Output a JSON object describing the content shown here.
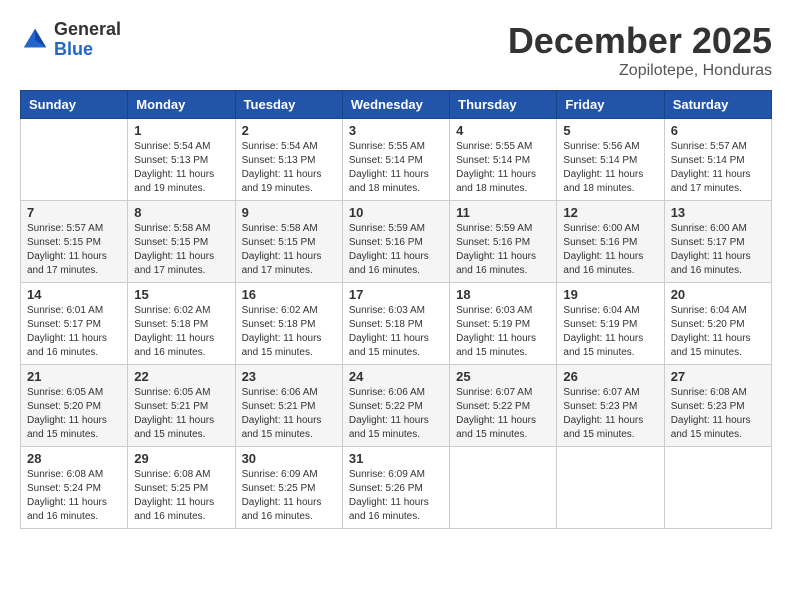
{
  "header": {
    "logo": {
      "general": "General",
      "blue": "Blue"
    },
    "title": "December 2025",
    "subtitle": "Zopilotepe, Honduras"
  },
  "calendar": {
    "days_of_week": [
      "Sunday",
      "Monday",
      "Tuesday",
      "Wednesday",
      "Thursday",
      "Friday",
      "Saturday"
    ],
    "weeks": [
      [
        {
          "day": "",
          "info": ""
        },
        {
          "day": "1",
          "info": "Sunrise: 5:54 AM\nSunset: 5:13 PM\nDaylight: 11 hours\nand 19 minutes."
        },
        {
          "day": "2",
          "info": "Sunrise: 5:54 AM\nSunset: 5:13 PM\nDaylight: 11 hours\nand 19 minutes."
        },
        {
          "day": "3",
          "info": "Sunrise: 5:55 AM\nSunset: 5:14 PM\nDaylight: 11 hours\nand 18 minutes."
        },
        {
          "day": "4",
          "info": "Sunrise: 5:55 AM\nSunset: 5:14 PM\nDaylight: 11 hours\nand 18 minutes."
        },
        {
          "day": "5",
          "info": "Sunrise: 5:56 AM\nSunset: 5:14 PM\nDaylight: 11 hours\nand 18 minutes."
        },
        {
          "day": "6",
          "info": "Sunrise: 5:57 AM\nSunset: 5:14 PM\nDaylight: 11 hours\nand 17 minutes."
        }
      ],
      [
        {
          "day": "7",
          "info": "Sunrise: 5:57 AM\nSunset: 5:15 PM\nDaylight: 11 hours\nand 17 minutes."
        },
        {
          "day": "8",
          "info": "Sunrise: 5:58 AM\nSunset: 5:15 PM\nDaylight: 11 hours\nand 17 minutes."
        },
        {
          "day": "9",
          "info": "Sunrise: 5:58 AM\nSunset: 5:15 PM\nDaylight: 11 hours\nand 17 minutes."
        },
        {
          "day": "10",
          "info": "Sunrise: 5:59 AM\nSunset: 5:16 PM\nDaylight: 11 hours\nand 16 minutes."
        },
        {
          "day": "11",
          "info": "Sunrise: 5:59 AM\nSunset: 5:16 PM\nDaylight: 11 hours\nand 16 minutes."
        },
        {
          "day": "12",
          "info": "Sunrise: 6:00 AM\nSunset: 5:16 PM\nDaylight: 11 hours\nand 16 minutes."
        },
        {
          "day": "13",
          "info": "Sunrise: 6:00 AM\nSunset: 5:17 PM\nDaylight: 11 hours\nand 16 minutes."
        }
      ],
      [
        {
          "day": "14",
          "info": "Sunrise: 6:01 AM\nSunset: 5:17 PM\nDaylight: 11 hours\nand 16 minutes."
        },
        {
          "day": "15",
          "info": "Sunrise: 6:02 AM\nSunset: 5:18 PM\nDaylight: 11 hours\nand 16 minutes."
        },
        {
          "day": "16",
          "info": "Sunrise: 6:02 AM\nSunset: 5:18 PM\nDaylight: 11 hours\nand 15 minutes."
        },
        {
          "day": "17",
          "info": "Sunrise: 6:03 AM\nSunset: 5:18 PM\nDaylight: 11 hours\nand 15 minutes."
        },
        {
          "day": "18",
          "info": "Sunrise: 6:03 AM\nSunset: 5:19 PM\nDaylight: 11 hours\nand 15 minutes."
        },
        {
          "day": "19",
          "info": "Sunrise: 6:04 AM\nSunset: 5:19 PM\nDaylight: 11 hours\nand 15 minutes."
        },
        {
          "day": "20",
          "info": "Sunrise: 6:04 AM\nSunset: 5:20 PM\nDaylight: 11 hours\nand 15 minutes."
        }
      ],
      [
        {
          "day": "21",
          "info": "Sunrise: 6:05 AM\nSunset: 5:20 PM\nDaylight: 11 hours\nand 15 minutes."
        },
        {
          "day": "22",
          "info": "Sunrise: 6:05 AM\nSunset: 5:21 PM\nDaylight: 11 hours\nand 15 minutes."
        },
        {
          "day": "23",
          "info": "Sunrise: 6:06 AM\nSunset: 5:21 PM\nDaylight: 11 hours\nand 15 minutes."
        },
        {
          "day": "24",
          "info": "Sunrise: 6:06 AM\nSunset: 5:22 PM\nDaylight: 11 hours\nand 15 minutes."
        },
        {
          "day": "25",
          "info": "Sunrise: 6:07 AM\nSunset: 5:22 PM\nDaylight: 11 hours\nand 15 minutes."
        },
        {
          "day": "26",
          "info": "Sunrise: 6:07 AM\nSunset: 5:23 PM\nDaylight: 11 hours\nand 15 minutes."
        },
        {
          "day": "27",
          "info": "Sunrise: 6:08 AM\nSunset: 5:23 PM\nDaylight: 11 hours\nand 15 minutes."
        }
      ],
      [
        {
          "day": "28",
          "info": "Sunrise: 6:08 AM\nSunset: 5:24 PM\nDaylight: 11 hours\nand 16 minutes."
        },
        {
          "day": "29",
          "info": "Sunrise: 6:08 AM\nSunset: 5:25 PM\nDaylight: 11 hours\nand 16 minutes."
        },
        {
          "day": "30",
          "info": "Sunrise: 6:09 AM\nSunset: 5:25 PM\nDaylight: 11 hours\nand 16 minutes."
        },
        {
          "day": "31",
          "info": "Sunrise: 6:09 AM\nSunset: 5:26 PM\nDaylight: 11 hours\nand 16 minutes."
        },
        {
          "day": "",
          "info": ""
        },
        {
          "day": "",
          "info": ""
        },
        {
          "day": "",
          "info": ""
        }
      ]
    ]
  }
}
